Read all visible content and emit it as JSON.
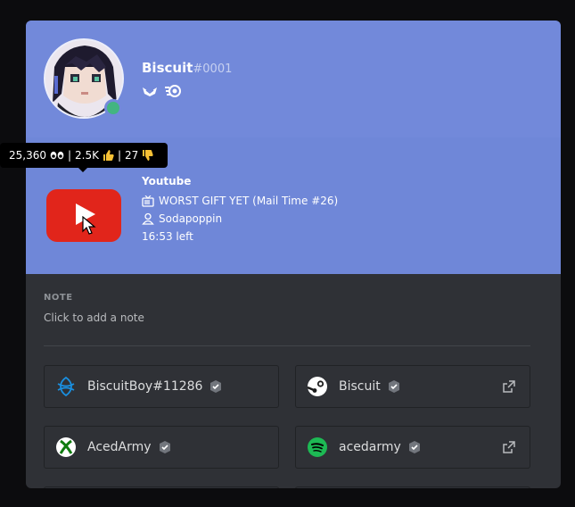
{
  "profile": {
    "username": "Biscuit",
    "discriminator": "#0001",
    "badges": [
      "hypesquad-icon",
      "nitro-icon"
    ],
    "status_color": "#43b581"
  },
  "tooltip": {
    "views": "25,360",
    "likes": "2.5K",
    "dislikes": "27",
    "sep": "|"
  },
  "activity": {
    "app": "Youtube",
    "video_title": "WORST GIFT YET (Mail Time #26)",
    "channel": "Sodapoppin",
    "time_left": "16:53 left"
  },
  "note": {
    "label": "NOTE",
    "placeholder": "Click to add a note"
  },
  "accounts": [
    {
      "service": "battlenet",
      "name": "BiscuitBoy#11286",
      "verified": true,
      "external_link": false
    },
    {
      "service": "steam",
      "name": "Biscuit",
      "verified": true,
      "external_link": true
    },
    {
      "service": "xbox",
      "name": "AcedArmy",
      "verified": true,
      "external_link": false
    },
    {
      "service": "spotify",
      "name": "acedarmy",
      "verified": true,
      "external_link": true
    }
  ],
  "colors": {
    "header": "#7289da",
    "body": "#2f3136",
    "youtube": "#e1251b",
    "spotify": "#1db954",
    "xbox": "#107c10"
  }
}
